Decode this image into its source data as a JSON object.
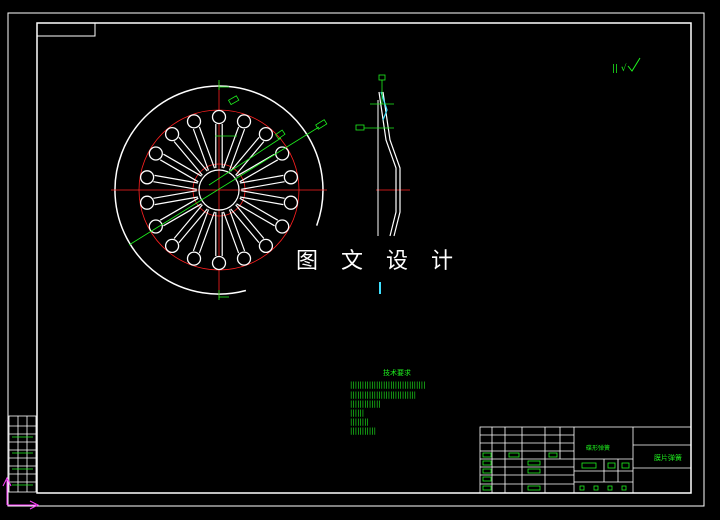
{
  "watermark": "图 文 设 计",
  "tech_requirements": {
    "title": "技术要求",
    "lines": [
      "||||||||||||||||||||||||||||||||",
      "||||||||||||||||||||||||||||",
      "|||||||||||||",
      "||||||",
      "||||||||",
      "|||||||||||"
    ]
  },
  "title_block": {
    "drawing_name": "碟形弹簧",
    "part_label": "膜片弹簧"
  },
  "corner_mark": "|| √",
  "colors": {
    "frame": "#ffffff",
    "green": "#1ef01e",
    "red": "#ff2020",
    "cyan": "#40e0ff",
    "magenta": "#ff40ff"
  }
}
